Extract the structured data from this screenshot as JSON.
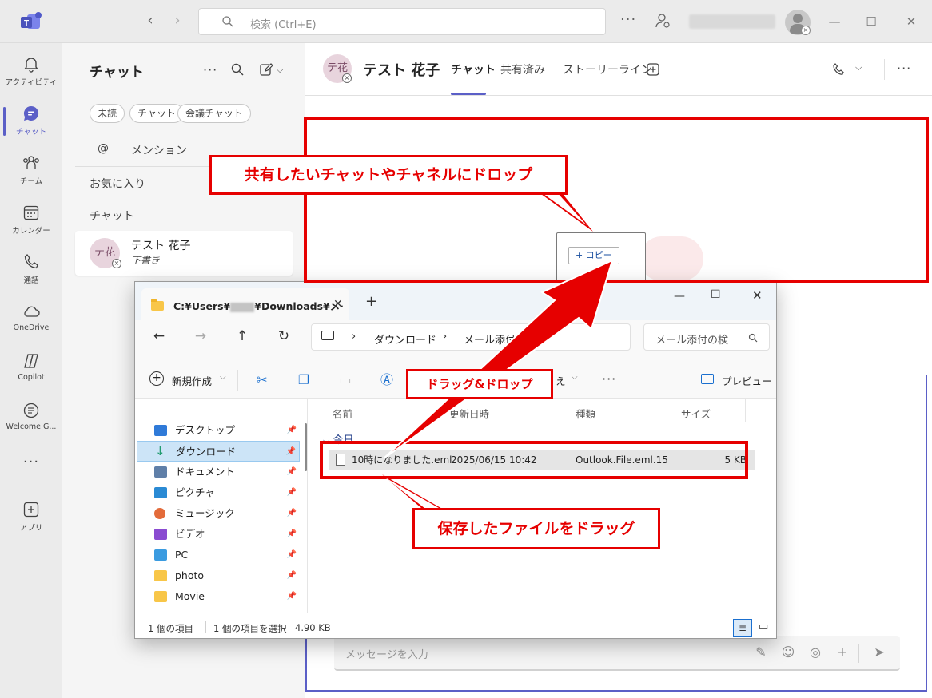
{
  "titlebar": {
    "search_placeholder": "検索 (Ctrl+E)",
    "more": "···"
  },
  "rail": [
    {
      "label": "アクティビティ",
      "icon": "bell-icon"
    },
    {
      "label": "チャット",
      "icon": "chat-icon",
      "active": true
    },
    {
      "label": "チーム",
      "icon": "teams-icon"
    },
    {
      "label": "カレンダー",
      "icon": "calendar-icon"
    },
    {
      "label": "通話",
      "icon": "phone-icon"
    },
    {
      "label": "OneDrive",
      "icon": "cloud-icon"
    },
    {
      "label": "Copilot",
      "icon": "copilot-icon"
    },
    {
      "label": "Welcome G...",
      "icon": "welcome-icon"
    },
    {
      "label": "アプリ",
      "icon": "add-apps-icon"
    }
  ],
  "chat_list": {
    "title": "チャット",
    "filters": [
      "未読",
      "チャット",
      "会議チャット"
    ],
    "mention": "メンション",
    "favorites": "お気に入り",
    "chats_section": "チャット",
    "item": {
      "avatar": "テ花",
      "name": "テスト 花子",
      "preview": "下書き"
    }
  },
  "chat_header": {
    "avatar": "テ花",
    "name": "テスト 花子",
    "tabs": [
      "チャット",
      "共有済み",
      "ストーリーライン"
    ]
  },
  "compose": {
    "placeholder": "メッセージを入力"
  },
  "drag": {
    "badge": "+ コピー"
  },
  "explorer": {
    "tab_title": "C:¥Users¥",
    "tab_title_rest": "¥Downloads¥メ·",
    "breadcrumb": [
      "ダウンロード",
      "メール添付"
    ],
    "search_placeholder": "メール添付の検",
    "new_button": "新規作成",
    "preview_button": "プレビュー",
    "sort_partial": "え",
    "sidebar": [
      {
        "label": "デスクトップ",
        "color": "#2f7ad8"
      },
      {
        "label": "ダウンロード",
        "color": "#1d9a6c",
        "selected": true
      },
      {
        "label": "ドキュメント",
        "color": "#5f7fa8"
      },
      {
        "label": "ピクチャ",
        "color": "#2a8ad4"
      },
      {
        "label": "ミュージック",
        "color": "#e36b3a"
      },
      {
        "label": "ビデオ",
        "color": "#8a4bd1"
      },
      {
        "label": "PC",
        "color": "#3a9be0"
      },
      {
        "label": "photo",
        "color": "#f8c648"
      },
      {
        "label": "Movie",
        "color": "#f8c648"
      }
    ],
    "columns": [
      "名前",
      "更新日時",
      "種類",
      "サイズ"
    ],
    "group": "今日",
    "file": {
      "name": "10時になりました.eml",
      "date": "2025/06/15 10:42",
      "type": "Outlook.File.eml.15",
      "size": "5 KB"
    },
    "status": {
      "count": "1 個の項目",
      "selected": "1 個の項目を選択",
      "size": "4.90 KB"
    }
  },
  "annotations": {
    "drop": "共有したいチャットやチャネルにドロップ",
    "dragdrop": "ドラッグ&ドロップ",
    "drag_file": "保存したファイルをドラッグ"
  },
  "colors": {
    "accent": "#5b5fc7",
    "annotation": "#e60000"
  }
}
